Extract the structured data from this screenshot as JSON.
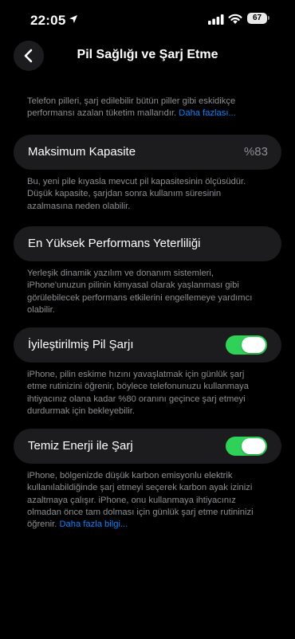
{
  "status": {
    "time": "22:05",
    "battery": "67",
    "icons": [
      "location-arrow-icon",
      "cellular-signal-icon",
      "wifi-icon",
      "battery-icon"
    ]
  },
  "nav": {
    "back_icon": "chevron-left-icon",
    "title": "Pil Sağlığı ve Şarj Etme"
  },
  "intro": {
    "text": "Telefon pilleri, şarj edilebilir bütün piller gibi eskidikçe performansı azalan tüketim mallarıdır.",
    "link": "Daha fazlası..."
  },
  "capacity": {
    "label": "Maksimum Kapasite",
    "value": "%83",
    "note": "Bu, yeni pile kıyasla mevcut pil kapasitesinin ölçüsüdür. Düşük kapasite, şarjdan sonra kullanım süresinin azalmasına neden olabilir."
  },
  "performance": {
    "label": "En Yüksek Performans Yeterliliği",
    "note": "Yerleşik dinamik yazılım ve donanım sistemleri, iPhone'unuzun pilinin kimyasal olarak yaşlanması gibi görülebilecek performans etkilerini engellemeye yardımcı olabilir."
  },
  "optimized": {
    "label": "İyileştirilmiş Pil Şarjı",
    "enabled": true,
    "note": "iPhone, pilin eskime hızını yavaşlatmak için günlük şarj etme rutinizini öğrenir, böylece telefonunuzu kullanmaya ihtiyacınız olana kadar %80 oranını geçince şarj etmeyi durdurmak için bekleyebilir."
  },
  "clean": {
    "label": "Temiz Enerji ile Şarj",
    "enabled": true,
    "note": "iPhone, bölgenizde düşük karbon emisyonlu elektrik kullanılabildiğinde şarj etmeyi seçerek karbon ayak izinizi azaltmaya çalışır. iPhone, onu kullanmaya ihtiyacınız olmadan önce tam dolması için günlük şarj etme rutininizi öğrenir.",
    "link": "Daha fazla bilgi..."
  },
  "colors": {
    "background": "#000000",
    "cell": "#1c1c1e",
    "secondary_text": "#8e8e93",
    "link": "#0a84ff",
    "toggle_on": "#30d158"
  }
}
